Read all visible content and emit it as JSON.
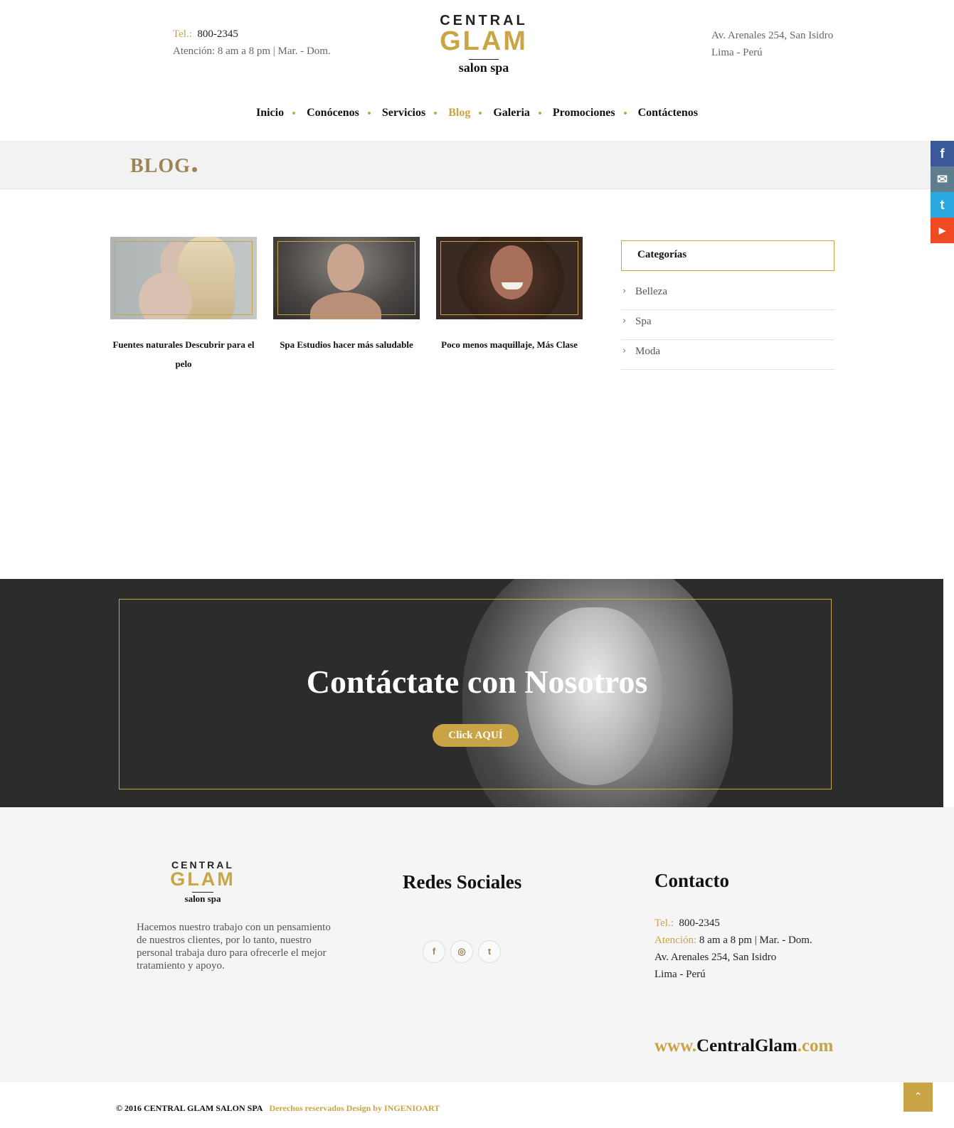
{
  "header": {
    "tel_label": "Tel.:",
    "tel_value": "800-2345",
    "hours": "Atención: 8 am a 8 pm  |  Mar. - Dom.",
    "address_line1": "Av. Arenales  254, San Isidro",
    "address_line2": "Lima - Perú"
  },
  "logo": {
    "line1": "CENTRAL",
    "line2": "GLAM",
    "line3": "salon spa"
  },
  "nav": {
    "items": [
      "Inicio",
      "Conócenos",
      "Servicios",
      "Blog",
      "Galeria",
      "Promociones",
      "Contáctenos"
    ],
    "active": "Blog"
  },
  "page_title": "BLOG",
  "side_social": [
    "f",
    "✉",
    "t",
    "▶"
  ],
  "colors": {
    "accent": "#c8a447",
    "facebook": "#3b5998",
    "email": "#5e7d8f",
    "twitter": "#2aa9e0",
    "youtube": "#ef4a23"
  },
  "posts": [
    {
      "title": "Fuentes naturales Descubrir para el pelo"
    },
    {
      "title": "Spa Estudios hacer más saludable"
    },
    {
      "title": "Poco menos maquillaje, Más Clase"
    }
  ],
  "categories": {
    "heading": "Categorías",
    "items": [
      "Belleza",
      "Spa",
      "Moda"
    ]
  },
  "cta": {
    "heading": "Contáctate con Nosotros",
    "button": "Click AQUÍ"
  },
  "footer": {
    "about": "Hacemos nuestro trabajo con un pensamiento de nuestros clientes, por lo tanto, nuestro personal trabaja duro para ofrecerle el mejor tratamiento y apoyo.",
    "social_heading": "Redes Sociales",
    "social_icons": [
      "f",
      "◎",
      "t"
    ],
    "contact_heading": "Contacto",
    "tel_label": "Tel.:",
    "tel_value": "800-2345",
    "hours_label": "Atención:",
    "hours_value": "8 am a 8 pm  |  Mar. - Dom.",
    "address_line1": "Av. Arenales  254, San Isidro",
    "address_line2": "Lima - Perú",
    "www_prefix": "www.",
    "www_name": "CentralGlam",
    "www_suffix": ".com"
  },
  "copyright": {
    "text": "© 2016   CENTRAL GLAM SALON SPA",
    "credits": "Derechos reservados Design by INGENIOART"
  },
  "to_top": "⌃"
}
